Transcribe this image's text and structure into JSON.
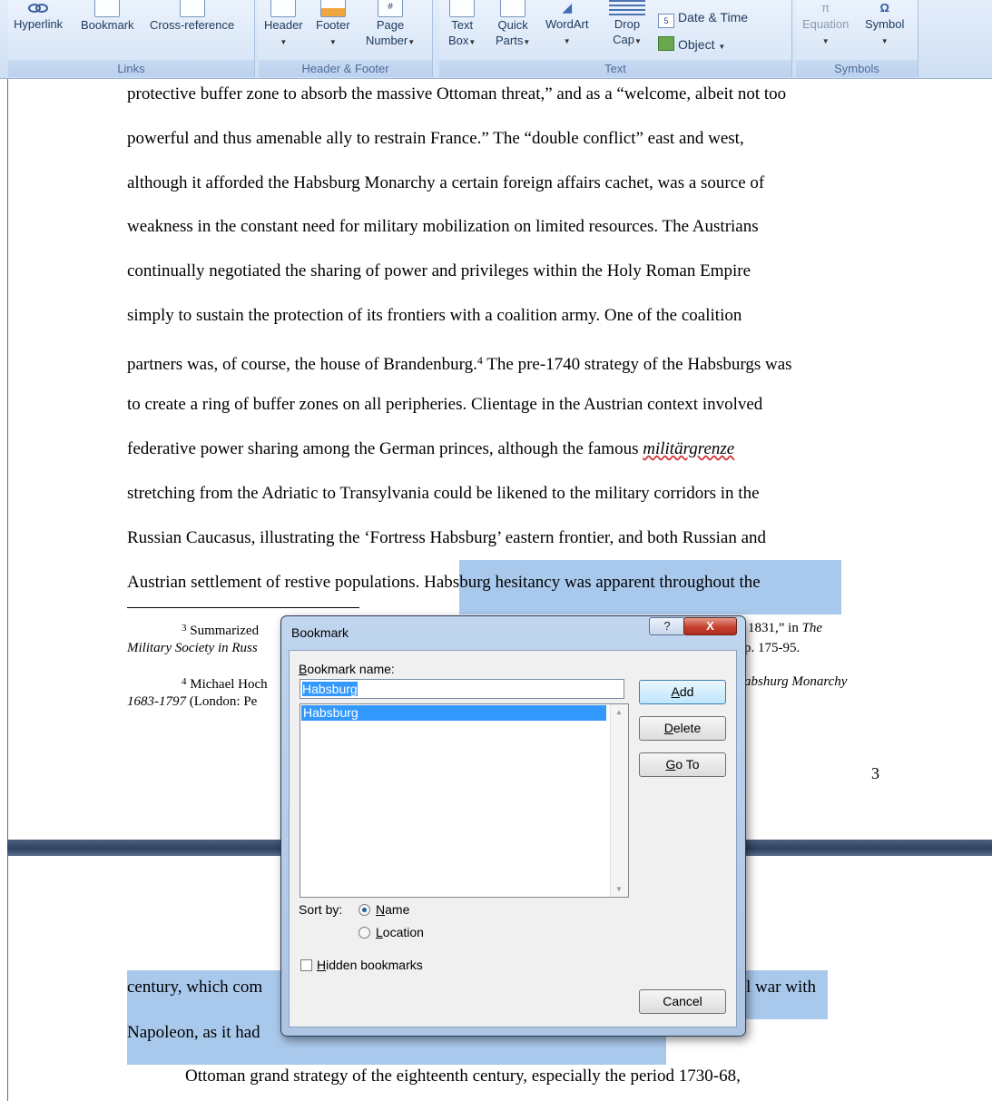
{
  "ribbon": {
    "groups": {
      "links": {
        "label": "Links",
        "hyperlink": "Hyperlink",
        "bookmark": "Bookmark",
        "cross_reference": "Cross-reference"
      },
      "header_footer": {
        "label": "Header & Footer",
        "header": "Header",
        "footer": "Footer",
        "page_number_1": "Page",
        "page_number_2": "Number"
      },
      "text": {
        "label": "Text",
        "text_box_1": "Text",
        "text_box_2": "Box",
        "quick_parts_1": "Quick",
        "quick_parts_2": "Parts",
        "wordart": "WordArt",
        "drop_cap_1": "Drop",
        "drop_cap_2": "Cap",
        "date_time": "Date & Time",
        "object": "Object"
      },
      "symbols": {
        "label": "Symbols",
        "equation": "Equation",
        "symbol": "Symbol"
      }
    }
  },
  "document": {
    "lines": [
      "protective buffer zone to absorb the massive Ottoman threat,” and as a “welcome, albeit not too",
      "powerful and thus amenable ally to restrain France.” The “double conflict” east and west,",
      "although it afforded the Habsburg Monarchy a certain foreign affairs cachet, was a source of",
      "weakness in the constant need for military mobilization on limited resources. The Austrians",
      "continually negotiated the sharing of power and privileges within the Holy Roman Empire",
      "simply to sustain the protection of its frontiers with a coalition army. One of the coalition"
    ],
    "line7a": "partners was, of course, the house of Brandenburg.",
    "line7_sup": "4",
    "line7b": " The pre-1740 strategy of the Habsburgs was",
    "line8": "to create a ring of buffer zones on all peripheries.  Clientage in the Austrian context involved",
    "line9a": "federative power sharing among the German princes, although the famous ",
    "line9_word": "militärgrenze",
    "line10": "stretching from the Adriatic to Transylvania could be likened to the military corridors in the",
    "line11": "Russian Caucasus, illustrating the ‘Fortress Habsburg’ eastern frontier, and both Russian and",
    "line12a": "Austrian settlement of restive populations. ",
    "line12b": "Habsburg hesitancy was apparent throughout the",
    "fn3_num": "3",
    "fn3_a": " Summarized",
    "fn3_right": "1831,” in ",
    "fn3_italic": "The",
    "fn3_line2": "Military Society in Russ",
    "fn3_line2_right": "p. 175-95.",
    "fn4_num": "4",
    "fn4_a": " Michael Hoch",
    "fn4_right": "abshurg Monarchy",
    "fn4_line2_italic": "1683-1797",
    "fn4_line2": " (London: Pe",
    "page_number": "3",
    "page2_line1_left": "century, which com",
    "page2_line1_right": "l war with",
    "page2_line2_left": "Napoleon, as it had",
    "page2_line3": "Ottoman grand strategy of the eighteenth century, especially the period 1730-68,"
  },
  "dialog": {
    "title": "Bookmark",
    "help_glyph": "?",
    "close_glyph": "X",
    "name_label": "Bookmark name:",
    "name_value": "Habsburg",
    "list_items": [
      "Habsburg"
    ],
    "buttons": {
      "add": "Add",
      "delete": "Delete",
      "goto": "Go To",
      "cancel": "Cancel"
    },
    "sort_label": "Sort by:",
    "sort_options": [
      "Name",
      "Location"
    ],
    "sort_selected": "Name",
    "hidden_label": "Hidden bookmarks",
    "hidden_checked": false
  }
}
